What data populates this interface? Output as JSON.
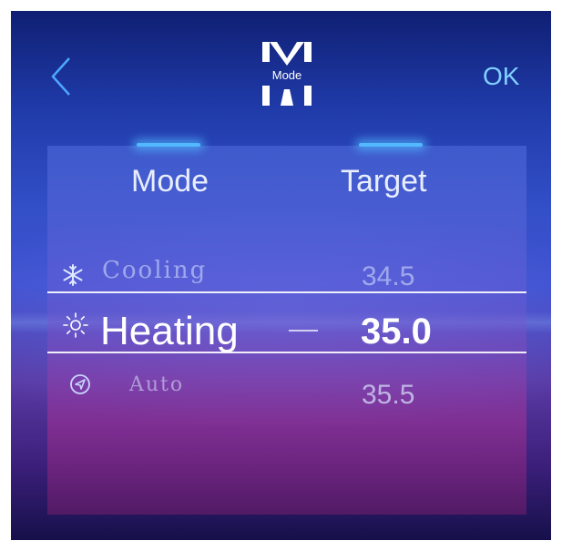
{
  "header": {
    "back_icon": "chevron-left-icon",
    "logo_letter": "M",
    "logo_label": "Mode",
    "ok_label": "OK"
  },
  "columns": {
    "mode": "Mode",
    "target": "Target"
  },
  "rows": [
    {
      "icon": "snowflake-icon",
      "mode": "Cooling",
      "target": "34.5",
      "selected": false
    },
    {
      "icon": "sun-icon",
      "mode": "Heating",
      "target": "35.0",
      "selected": true
    },
    {
      "icon": "navigation-icon",
      "mode": "Auto",
      "target": "35.5",
      "selected": false
    }
  ],
  "colors": {
    "accent": "#52b8ff",
    "ok": "#7fd0ff",
    "selected_text": "#ffffff"
  }
}
